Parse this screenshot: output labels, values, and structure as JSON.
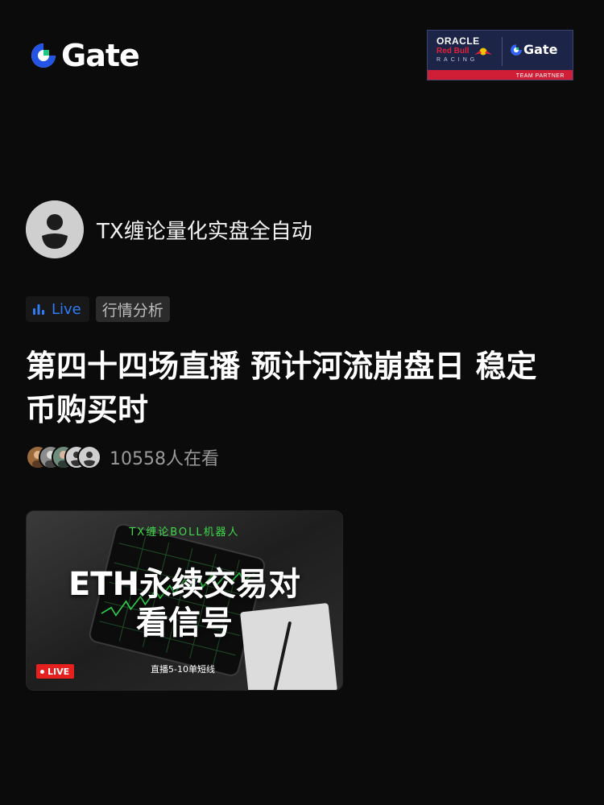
{
  "brand": {
    "name": "Gate",
    "logo_icon": "gate-logo-icon"
  },
  "partner_badge": {
    "line1": "ORACLE",
    "line2": "Red Bull",
    "line3": "RACING",
    "brand": "Gate",
    "band_text": "TEAM PARTNER",
    "bg_color": "#1c2448",
    "band_color": "#cf1e35"
  },
  "author": {
    "name": "TX缠论量化实盘全自动",
    "avatar_icon": "default-avatar-icon"
  },
  "tags": {
    "live_label": "Live",
    "live_icon": "bar-chart-icon",
    "category": "行情分析",
    "live_color": "#2e7cf6"
  },
  "post": {
    "title": "第四十四场直播 预计河流崩盘日 稳定币购买时"
  },
  "viewers": {
    "count_text": "10558人在看"
  },
  "thumbnail": {
    "subtitle": "TX缠论BOLL机器人",
    "headline_line1": "ETH永续交易对",
    "headline_line2": "看信号",
    "live_badge": "LIVE",
    "caption": "直播5-10单短线",
    "live_badge_color": "#e5201e",
    "subtitle_color": "#3fd94a"
  }
}
